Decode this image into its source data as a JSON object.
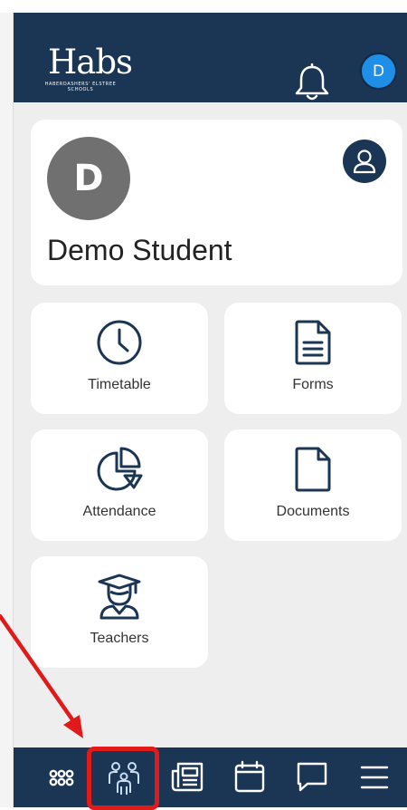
{
  "header": {
    "logo_title": "Habs",
    "logo_subtitle": "HABERDASHERS' ELSTREE SCHOOLS",
    "avatar_initial": "D"
  },
  "profile": {
    "initial": "D",
    "name": "Demo Student"
  },
  "tiles": [
    {
      "label": "Timetable",
      "icon": "clock-icon"
    },
    {
      "label": "Forms",
      "icon": "document-lines-icon"
    },
    {
      "label": "Attendance",
      "icon": "pie-chart-icon"
    },
    {
      "label": "Documents",
      "icon": "blank-document-icon"
    },
    {
      "label": "Teachers",
      "icon": "graduate-icon"
    }
  ],
  "bottom_nav": [
    {
      "name": "apps",
      "icon": "grid-dots-icon"
    },
    {
      "name": "people",
      "icon": "people-icon",
      "highlighted": true
    },
    {
      "name": "news",
      "icon": "newspaper-icon"
    },
    {
      "name": "calendar",
      "icon": "calendar-icon"
    },
    {
      "name": "messages",
      "icon": "chat-icon"
    },
    {
      "name": "menu",
      "icon": "hamburger-icon"
    }
  ],
  "colors": {
    "navy": "#1b3555",
    "accent_blue": "#1f8ee6",
    "annotation_red": "#e01919",
    "background": "#eeeeee"
  }
}
